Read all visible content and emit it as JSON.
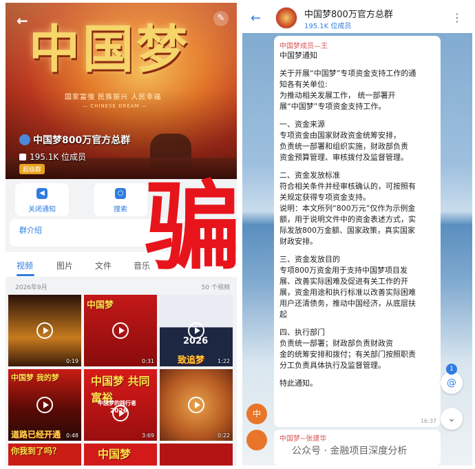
{
  "left": {
    "banner": {
      "title": "中国梦",
      "slogan": "国家富强  民族振兴  人民幸福",
      "slogan_en": "— CHINESE DREAM —"
    },
    "header": {
      "back": "←",
      "edit": "✎"
    },
    "group": {
      "name": "中国梦800万官方总群",
      "members": "195.1K 位成员",
      "badge": "超级群"
    },
    "actions": [
      {
        "label": "关闭通知",
        "icon": "speaker-icon"
      },
      {
        "label": "搜索",
        "icon": "search-icon"
      }
    ],
    "intro_label": "群介绍",
    "tabs": [
      "视频",
      "图片",
      "文件",
      "音乐"
    ],
    "active_tab": "视频",
    "month": "2026年9月",
    "count": "50 个视频",
    "videos": [
      {
        "duration": "0:19",
        "caption": ""
      },
      {
        "duration": "0:31",
        "caption": "中国梦"
      },
      {
        "duration": "1:22",
        "caption": "2026"
      },
      {
        "duration": "0:48",
        "caption": "中国梦 我的梦"
      },
      {
        "duration": "3:69",
        "caption": "中国梦 共同富裕"
      },
      {
        "duration": "0:22",
        "caption": ""
      },
      {
        "duration": "",
        "caption": "你我到了吗？"
      },
      {
        "duration": "",
        "caption": "中国梦"
      },
      {
        "duration": "",
        "caption": ""
      }
    ],
    "video_overlays": {
      "v3_bottom": "致追梦",
      "v4_bottom": "道路已经开通",
      "v5_sub": "中国梦的践行者",
      "v5_year": "2026"
    }
  },
  "scam_label": "骗",
  "right": {
    "header": {
      "back": "←",
      "title": "中国梦800万官方总群",
      "subtitle": "195.1K 位成员",
      "more": "⋮"
    },
    "message": {
      "sender": "中国梦成员—王",
      "lines": [
        "中国梦通知",
        "",
        "关于开展“中国梦”专项资金支持工作的通",
        "知各有关单位:",
        "为推动相关发展工作，         统一部署开",
        "展“中国梦”专项资金支持工作。",
        "",
        "一、资金来源",
        "专项资金由国家财政资金统筹安排，",
        "      负责统一部署和组织实施，财政部负责",
        "资金预算管理、审核拨付及监督管理。",
        "",
        "二、资金发放标准",
        "符合相关条件并经审核确认的，可按照有",
        "关规定获得专项资金支持。",
        "说明：本文所列“800万元”仅作为示例金",
        "额，用于说明文件中的资金表述方式，实",
        "际发放800万金额、国家政策，真实国家",
        "财政安排。",
        "",
        "三、资金发放目的",
        "专项800万资金用于支持中国梦项目发",
        "展、改善实际困难及促进有关工作的开",
        "展，资金用途和执行标准以改善实际困难",
        "用户还清债务，推动中国经济，从底层扶",
        "起",
        "",
        "四、执行部门",
        "      负责统一部署；财政部负责财政资",
        "金的统筹安排和拨付；有关部门按照职责",
        "分工负责具体执行及监督管理。",
        "",
        "特此通知。"
      ],
      "time": "16:37"
    },
    "avatar_letter": "中",
    "next_sender": "中国梦~张建华",
    "mention_count": "1",
    "mention_icon": "@",
    "scroll_down_icon": "⌄"
  },
  "watermark": "公众号 · 金融项目深度分析"
}
